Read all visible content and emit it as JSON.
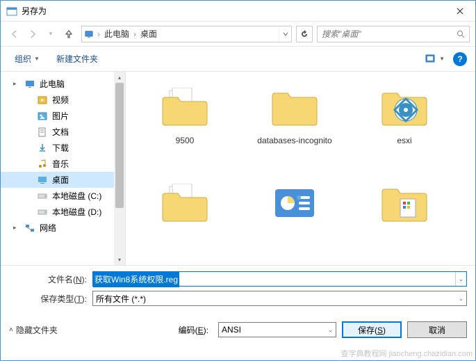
{
  "window": {
    "title": "另存为"
  },
  "breadcrumb": {
    "root": "此电脑",
    "current": "桌面"
  },
  "search": {
    "placeholder": "搜索\"桌面\""
  },
  "toolbar": {
    "organize": "组织",
    "new_folder": "新建文件夹"
  },
  "sidebar": {
    "items": [
      {
        "label": "此电脑",
        "icon": "pc",
        "expand": true
      },
      {
        "label": "视频",
        "icon": "video",
        "sub": true
      },
      {
        "label": "图片",
        "icon": "pictures",
        "sub": true
      },
      {
        "label": "文档",
        "icon": "documents",
        "sub": true
      },
      {
        "label": "下载",
        "icon": "downloads",
        "sub": true
      },
      {
        "label": "音乐",
        "icon": "music",
        "sub": true
      },
      {
        "label": "桌面",
        "icon": "desktop",
        "sub": true,
        "selected": true
      },
      {
        "label": "本地磁盘 (C:)",
        "icon": "disk",
        "sub": true
      },
      {
        "label": "本地磁盘 (D:)",
        "icon": "disk",
        "sub": true
      },
      {
        "label": "网络",
        "icon": "network",
        "expand": true
      }
    ]
  },
  "files": [
    {
      "label": "9500",
      "type": "folder-doc"
    },
    {
      "label": "databases-incognito",
      "type": "folder"
    },
    {
      "label": "esxi",
      "type": "folder-tv"
    },
    {
      "label": "",
      "type": "folder-doc"
    },
    {
      "label": "",
      "type": "folder-gadget"
    },
    {
      "label": "",
      "type": "folder-app"
    }
  ],
  "filename": {
    "label_pre": "文件名(",
    "label_key": "N",
    "label_post": "):",
    "value": "获取Win8系统权限.reg"
  },
  "filetype": {
    "label_pre": "保存类型(",
    "label_key": "T",
    "label_post": "):",
    "value": "所有文件 (*.*)"
  },
  "encoding": {
    "label_pre": "编码(",
    "label_key": "E",
    "label_post": "):",
    "value": "ANSI"
  },
  "footer": {
    "hide_folders": "隐藏文件夹",
    "save_pre": "保存(",
    "save_key": "S",
    "save_post": ")",
    "cancel": "取消"
  },
  "watermark": "查字典教程网 jiaocheng.chazidian.com"
}
